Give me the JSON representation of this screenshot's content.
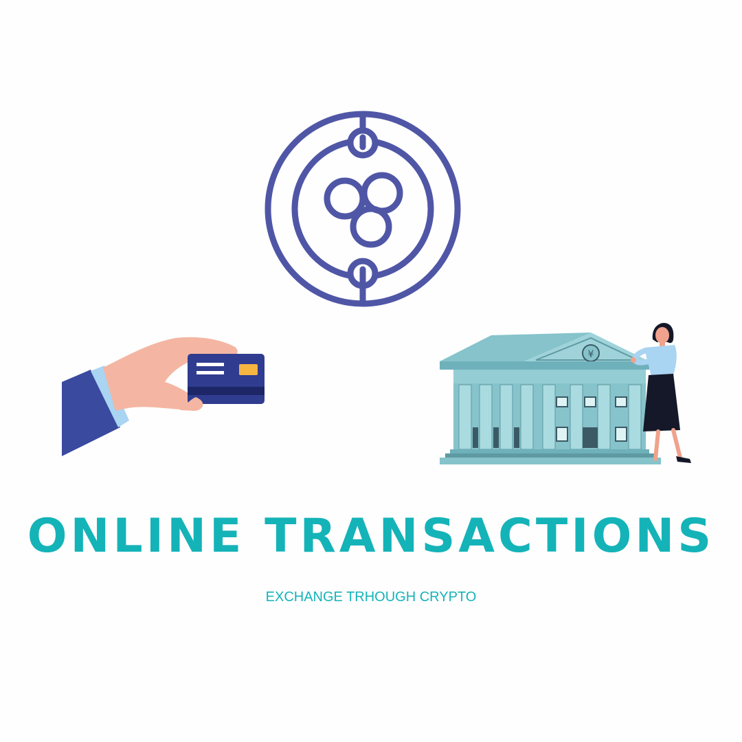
{
  "headline": "ONLINE TRANSACTIONS",
  "subline": "EXCHANGE TRHOUGH CRYPTO",
  "coin_symbol": "¥",
  "colors": {
    "background": "#fefefe",
    "accent_text": "#14b3b8",
    "crypto_icon": "#5056a6",
    "card_blue": "#2f3c8f",
    "sleeve_blue": "#3a4a9e",
    "cuff": "#a9d4f2",
    "skin": "#f4b6a2",
    "card_chip": "#f6b642",
    "bank_main": "#86c3cb",
    "bank_shadow": "#5f9aa3",
    "bank_dark": "#3b5a66",
    "skirt": "#141828"
  },
  "icons": {
    "crypto": "ripple-xrp-icon",
    "hand": "hand-holding-card-icon",
    "bank": "bank-building-icon",
    "person": "woman-figure-icon"
  }
}
